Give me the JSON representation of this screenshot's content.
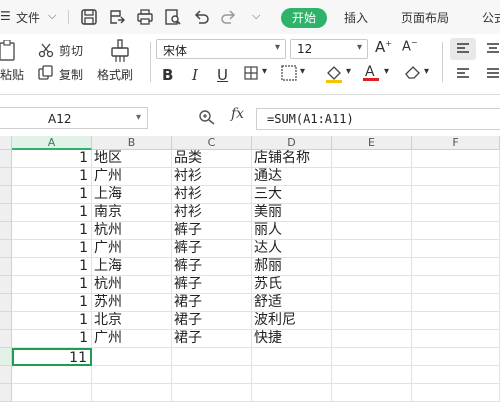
{
  "menu": {
    "file": "文件",
    "start": "开始",
    "insert": "插入",
    "page_layout": "页面布局",
    "formulas": "公式"
  },
  "ribbon": {
    "paste": "粘贴",
    "cut": "剪切",
    "copy": "复制",
    "format_painter": "格式刷",
    "font_name": "宋体",
    "font_size": "12"
  },
  "formula_bar": {
    "name_box": "A12",
    "fx": "fx",
    "formula": "=SUM(A1:A11)"
  },
  "sheet": {
    "columns": [
      "A",
      "B",
      "C",
      "D",
      "E",
      "F"
    ],
    "row_numbers": [
      "",
      "",
      "",
      "",
      "",
      "",
      "",
      "",
      "",
      "",
      "",
      "",
      "",
      ""
    ],
    "rows": [
      {
        "a": "1",
        "b": "地区",
        "c": "品类",
        "d": "店铺名称"
      },
      {
        "a": "1",
        "b": "广州",
        "c": "衬衫",
        "d": "通达"
      },
      {
        "a": "1",
        "b": "上海",
        "c": "衬衫",
        "d": "三大"
      },
      {
        "a": "1",
        "b": "南京",
        "c": "衬衫",
        "d": "美丽"
      },
      {
        "a": "1",
        "b": "杭州",
        "c": "裤子",
        "d": "丽人"
      },
      {
        "a": "1",
        "b": "广州",
        "c": "裤子",
        "d": "达人"
      },
      {
        "a": "1",
        "b": "上海",
        "c": "裤子",
        "d": "郝丽"
      },
      {
        "a": "1",
        "b": "杭州",
        "c": "裤子",
        "d": "苏氏"
      },
      {
        "a": "1",
        "b": "苏州",
        "c": "裙子",
        "d": "舒适"
      },
      {
        "a": "1",
        "b": "北京",
        "c": "裙子",
        "d": "波利尼"
      },
      {
        "a": "1",
        "b": "广州",
        "c": "裙子",
        "d": "快捷"
      },
      {
        "a": "11",
        "b": "",
        "c": "",
        "d": ""
      }
    ],
    "selected_cell": "A12",
    "accent": "#2fb36a"
  }
}
